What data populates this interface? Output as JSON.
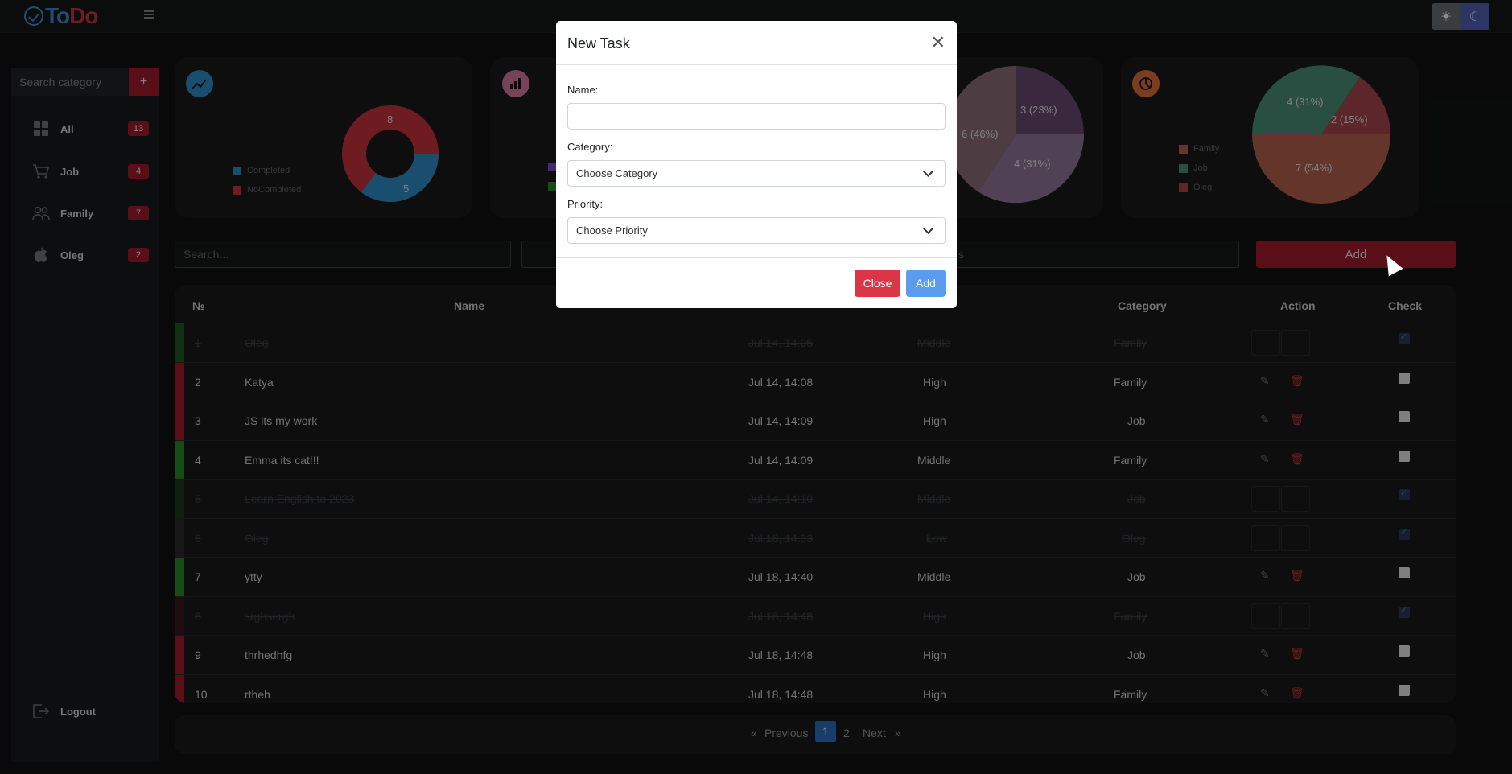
{
  "app": {
    "logo_to": "To",
    "logo_do": "Do"
  },
  "sidebar": {
    "search_placeholder": "Search category",
    "add_label": "+",
    "items": [
      {
        "label": "All",
        "count": "13",
        "icon": "grid-icon"
      },
      {
        "label": "Job",
        "count": "4",
        "icon": "cart-icon"
      },
      {
        "label": "Family",
        "count": "7",
        "icon": "people-icon"
      },
      {
        "label": "Oleg",
        "count": "2",
        "icon": "apple-icon"
      }
    ],
    "logout_label": "Logout"
  },
  "stats": {
    "completion": {
      "legend": [
        "Completed",
        "NoCompleted"
      ],
      "colors": [
        "#2e8fc8",
        "#c9343f"
      ],
      "labels": [
        "8",
        "5"
      ]
    },
    "priority_pie": {
      "labels": [
        "3 (23%)",
        "4 (31%)",
        "6 (46%)"
      ],
      "colors": [
        "#6b4a72",
        "#93799a",
        "#8f6e7a"
      ]
    },
    "category_pie": {
      "legend": [
        "Family",
        "Job",
        "Oleg"
      ],
      "colors": [
        "#b5614f",
        "#4b8f78",
        "#a9464f"
      ],
      "labels": [
        "4 (31%)",
        "2 (15%)",
        "7 (54%)"
      ]
    }
  },
  "toolbar": {
    "search_placeholder": "Search...",
    "search3_placeholder": "s",
    "add_label": "Add"
  },
  "table": {
    "headers": {
      "num": "№",
      "name": "Name",
      "category": "Category",
      "action": "Action",
      "check": "Check"
    },
    "rows": [
      {
        "num": "1",
        "name": "Oleg",
        "date": "Jul 14, 14:05",
        "priority": "Middle",
        "category": "Family",
        "done": true,
        "bar": "#1f5a25"
      },
      {
        "num": "2",
        "name": "Katya",
        "date": "Jul 14, 14:08",
        "priority": "High",
        "category": "Family",
        "done": false,
        "bar": "#a51d2d"
      },
      {
        "num": "3",
        "name": "JS its my work",
        "date": "Jul 14, 14:09",
        "priority": "High",
        "category": "Job",
        "done": false,
        "bar": "#a51d2d"
      },
      {
        "num": "4",
        "name": "Emma its cat!!!",
        "date": "Jul 14, 14:09",
        "priority": "Middle",
        "category": "Family",
        "done": false,
        "bar": "#2a8a2a"
      },
      {
        "num": "5",
        "name": "Learn English to 2023",
        "date": "Jul 14, 14:10",
        "priority": "Middle",
        "category": "Job",
        "done": true,
        "bar": "#1e3a20"
      },
      {
        "num": "6",
        "name": "Oleg",
        "date": "Jul 18, 14:33",
        "priority": "Low",
        "category": "Oleg",
        "done": true,
        "bar": "#2a2b2d"
      },
      {
        "num": "7",
        "name": "ytty",
        "date": "Jul 18, 14:40",
        "priority": "Middle",
        "category": "Job",
        "done": false,
        "bar": "#2a8a2a"
      },
      {
        "num": "8",
        "name": "srghsergh",
        "date": "Jul 18, 14:48",
        "priority": "High",
        "category": "Family",
        "done": true,
        "bar": "#3a1a1e"
      },
      {
        "num": "9",
        "name": "thrhedhfg",
        "date": "Jul 18, 14:48",
        "priority": "High",
        "category": "Job",
        "done": false,
        "bar": "#a51d2d"
      },
      {
        "num": "10",
        "name": "rtheh",
        "date": "Jul 18, 14:48",
        "priority": "High",
        "category": "Family",
        "done": false,
        "bar": "#a51d2d"
      }
    ]
  },
  "pagination": {
    "prev_arrow": "«",
    "previous": "Previous",
    "page1": "1",
    "page2": "2",
    "next": "Next",
    "next_arrow": "»"
  },
  "modal": {
    "title": "New Task",
    "name_label": "Name:",
    "name_value": "",
    "category_label": "Category:",
    "category_value": "Choose Category",
    "priority_label": "Priority:",
    "priority_value": "Choose Priority",
    "close_label": "Close",
    "add_label": "Add"
  }
}
